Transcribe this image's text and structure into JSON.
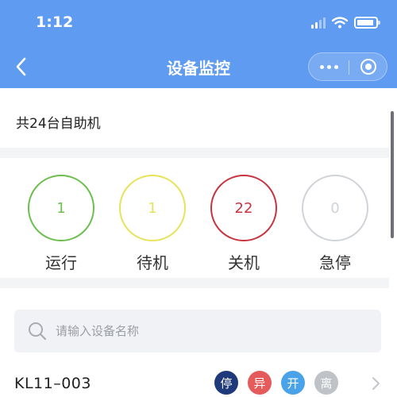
{
  "status_bar": {
    "time": "1:12"
  },
  "nav": {
    "title": "设备监控"
  },
  "summary": {
    "total_text": "共24台自助机"
  },
  "stats": [
    {
      "label": "运行",
      "count": "1",
      "color": "#6cbf4f"
    },
    {
      "label": "待机",
      "count": "1",
      "color": "#e6e35a"
    },
    {
      "label": "关机",
      "count": "22",
      "color": "#c8343f"
    },
    {
      "label": "急停",
      "count": "0",
      "color": "#d0d3d8"
    }
  ],
  "search": {
    "placeholder": "请输入设备名称",
    "value": ""
  },
  "devices": [
    {
      "name": "KL11–003",
      "badges": [
        {
          "label": "停",
          "color": "#1f3a7a"
        },
        {
          "label": "异",
          "color": "#e55a5a"
        },
        {
          "label": "开",
          "color": "#4aa3e8"
        },
        {
          "label": "离",
          "color": "#bfc2c7"
        }
      ]
    }
  ],
  "colors": {
    "header": "#5f9bf0",
    "separator": "#f3f4f6"
  }
}
